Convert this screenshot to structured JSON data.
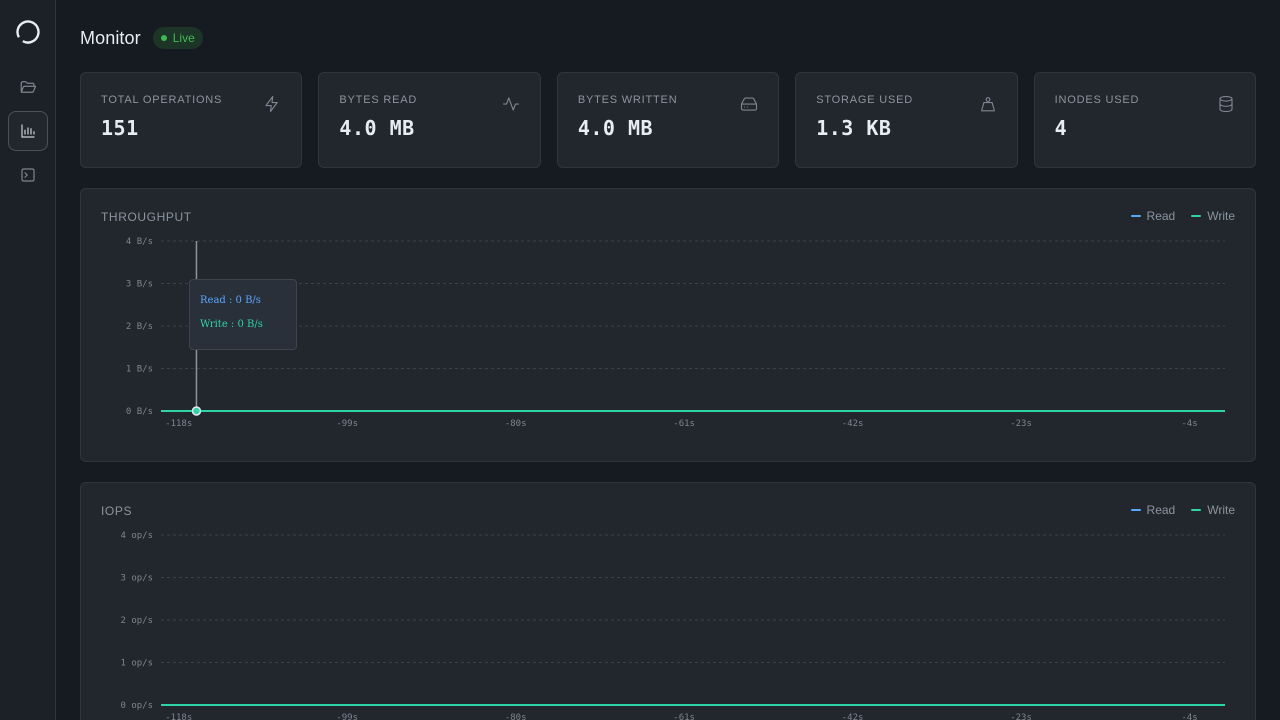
{
  "header": {
    "title": "Monitor",
    "badge": "Live"
  },
  "sidebar": {
    "items": [
      {
        "name": "files",
        "icon": "folder-open-icon",
        "active": false
      },
      {
        "name": "monitor",
        "icon": "bar-chart-icon",
        "active": true
      },
      {
        "name": "terminal",
        "icon": "terminal-icon",
        "active": false
      }
    ]
  },
  "stats": [
    {
      "label": "TOTAL OPERATIONS",
      "value": "151",
      "icon": "zap-icon"
    },
    {
      "label": "BYTES READ",
      "value": "4.0 MB",
      "icon": "activity-icon"
    },
    {
      "label": "BYTES WRITTEN",
      "value": "4.0 MB",
      "icon": "hard-drive-icon"
    },
    {
      "label": "STORAGE USED",
      "value": "1.3 KB",
      "icon": "weight-icon"
    },
    {
      "label": "INODES USED",
      "value": "4",
      "icon": "database-icon"
    }
  ],
  "colors": {
    "read": "#58a6ff",
    "write": "#2dd4a7",
    "grid": "#3a414a"
  },
  "chart_data": [
    {
      "type": "line",
      "title": "THROUGHPUT",
      "legend": [
        "Read",
        "Write"
      ],
      "yticks": [
        "0 B/s",
        "1 B/s",
        "2 B/s",
        "3 B/s",
        "4 B/s"
      ],
      "ylim": [
        0,
        4
      ],
      "xticks": [
        "-118s",
        "-99s",
        "-80s",
        "-61s",
        "-42s",
        "-23s",
        "-4s"
      ],
      "xlim": [
        -120,
        0
      ],
      "series": [
        {
          "name": "Read",
          "x": [
            -118,
            0
          ],
          "values": [
            0,
            0
          ]
        },
        {
          "name": "Write",
          "x": [
            -118,
            0
          ],
          "values": [
            0,
            0
          ]
        }
      ],
      "tooltip": {
        "x": -116,
        "read": "Read : 0 B/s",
        "write": "Write : 0 B/s"
      }
    },
    {
      "type": "line",
      "title": "IOPS",
      "legend": [
        "Read",
        "Write"
      ],
      "yticks": [
        "0 op/s",
        "1 op/s",
        "2 op/s",
        "3 op/s",
        "4 op/s"
      ],
      "ylim": [
        0,
        4
      ],
      "xticks": [
        "-118s",
        "-99s",
        "-80s",
        "-61s",
        "-42s",
        "-23s",
        "-4s"
      ],
      "xlim": [
        -120,
        0
      ],
      "series": [
        {
          "name": "Read",
          "x": [
            -118,
            0
          ],
          "values": [
            0,
            0
          ]
        },
        {
          "name": "Write",
          "x": [
            -118,
            0
          ],
          "values": [
            0,
            0
          ]
        }
      ]
    }
  ]
}
